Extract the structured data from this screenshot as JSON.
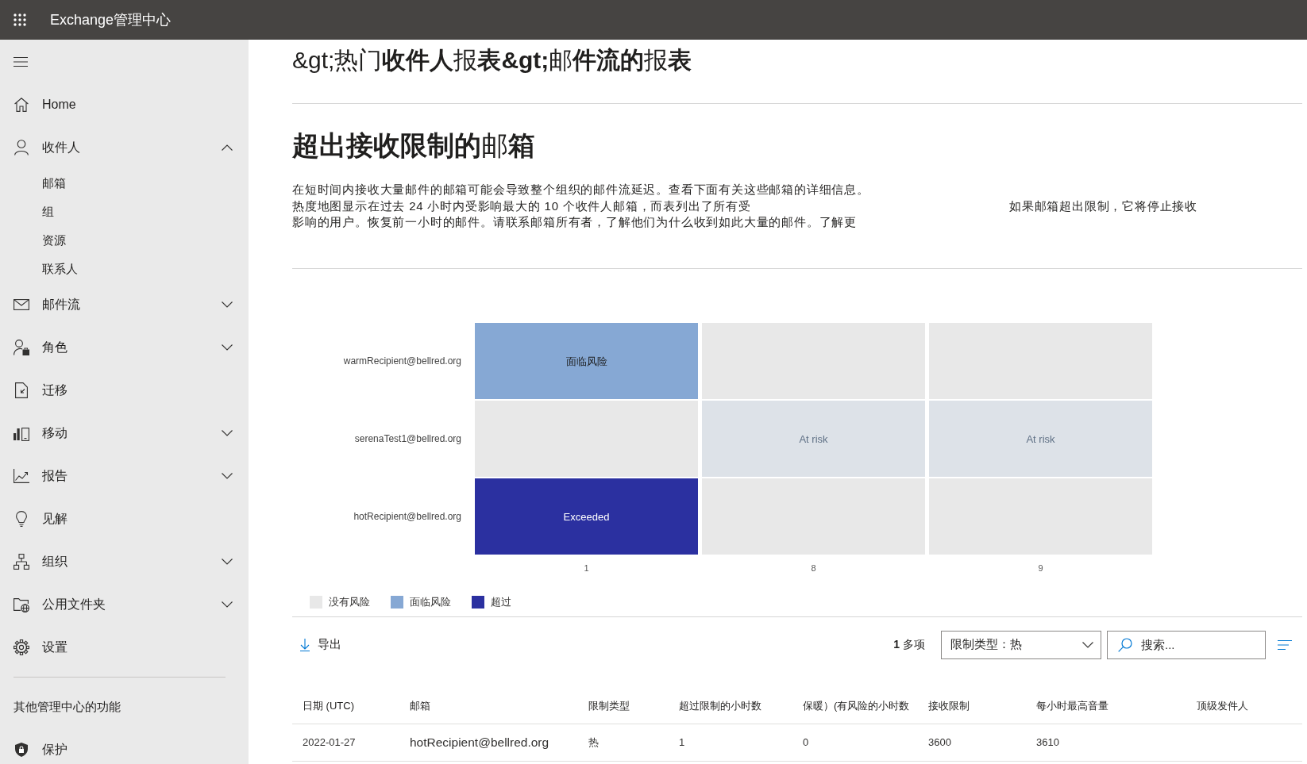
{
  "top_bar": {
    "title": "Exchange管理中心"
  },
  "sidebar": {
    "items": [
      {
        "label": "Home",
        "kind": "link"
      },
      {
        "label": "收件人",
        "kind": "group",
        "expanded": true,
        "children": [
          {
            "label": "邮箱"
          },
          {
            "label": "组"
          },
          {
            "label": "资源"
          },
          {
            "label": "联系人"
          }
        ]
      },
      {
        "label": "邮件流",
        "kind": "group",
        "expanded": false
      },
      {
        "label": "角色",
        "kind": "group",
        "expanded": false
      },
      {
        "label": "迁移",
        "kind": "link"
      },
      {
        "label": "移动",
        "kind": "group",
        "expanded": false
      },
      {
        "label": "报告",
        "kind": "group",
        "expanded": false
      },
      {
        "label": "见解",
        "kind": "link"
      },
      {
        "label": "组织",
        "kind": "group",
        "expanded": false
      },
      {
        "label": "公用文件夹",
        "kind": "group",
        "expanded": false
      },
      {
        "label": "设置",
        "kind": "link"
      }
    ],
    "section_title": "其他管理中心的功能",
    "section_items": [
      {
        "label": "保护"
      }
    ]
  },
  "page": {
    "breadcrumb": "&gt;热门**收件人**报**表&gt;**邮**件流的**报**表**",
    "heading": "**超出接收限制的**邮**箱**",
    "description_lines": [
      [
        "在短时间内接收大量邮件的邮箱可能会导致整个组织的邮件流延迟。查看下面有关这些邮箱的详细信息。"
      ],
      [
        "热度地图显示在过去 24 小时内受影响最大的 10 个收件人邮箱，而表列出了所有受",
        "如果邮箱超出限制，它将停止接收"
      ],
      [
        "影响的用户。恢复前一小时的邮件。请联系邮箱所有者，了解他们为什么收到如此大量的邮件。了解更"
      ]
    ]
  },
  "heatmap": {
    "chart_data": {
      "type": "heatmap",
      "categories": [
        "1",
        "8",
        "9"
      ],
      "y_categories": [
        "warmRecipient@bellred.org",
        "serenaTest1@bellred.org",
        "hotRecipient@bellred.org"
      ],
      "cells": [
        [
          {
            "kind": "at_risk",
            "label": "面临风险",
            "dimmed": false
          },
          {
            "kind": "none",
            "dimmed": false
          },
          {
            "kind": "none",
            "dimmed": false
          }
        ],
        [
          {
            "kind": "none",
            "dimmed": false
          },
          {
            "kind": "at_risk",
            "label": "At risk",
            "dimmed": true
          },
          {
            "kind": "at_risk",
            "label": "At risk",
            "dimmed": true
          }
        ],
        [
          {
            "kind": "exceeded",
            "label": "Exceeded",
            "dimmed": false
          },
          {
            "kind": "none",
            "dimmed": false
          },
          {
            "kind": "none",
            "dimmed": false
          }
        ]
      ]
    },
    "legend_items": [
      {
        "kind": "none",
        "label": "没有风险",
        "color": "#e8e8e8"
      },
      {
        "kind": "at_risk",
        "label": "面临风险",
        "color": "#86a8d4"
      },
      {
        "kind": "exceeded",
        "label": "超过",
        "color": "#2b30a0"
      }
    ]
  },
  "toolbar": {
    "export": "导出",
    "count": "**1** 多项",
    "filter": {
      "value": "限制类型：热"
    },
    "search": {
      "placeholder": "搜索..."
    }
  },
  "table": {
    "columns": [
      "日期 (UTC)",
      "邮箱",
      "限制类型",
      "超过限制的小时数",
      "保暖）(有风险的小时数",
      "接收限制",
      "每小时最高音量",
      "顶级发件人"
    ],
    "rows": [
      [
        "2022-01-27",
        "hotRecipient@bellred.org",
        "热",
        "1",
        "0",
        "3600",
        "3610"
      ]
    ]
  }
}
